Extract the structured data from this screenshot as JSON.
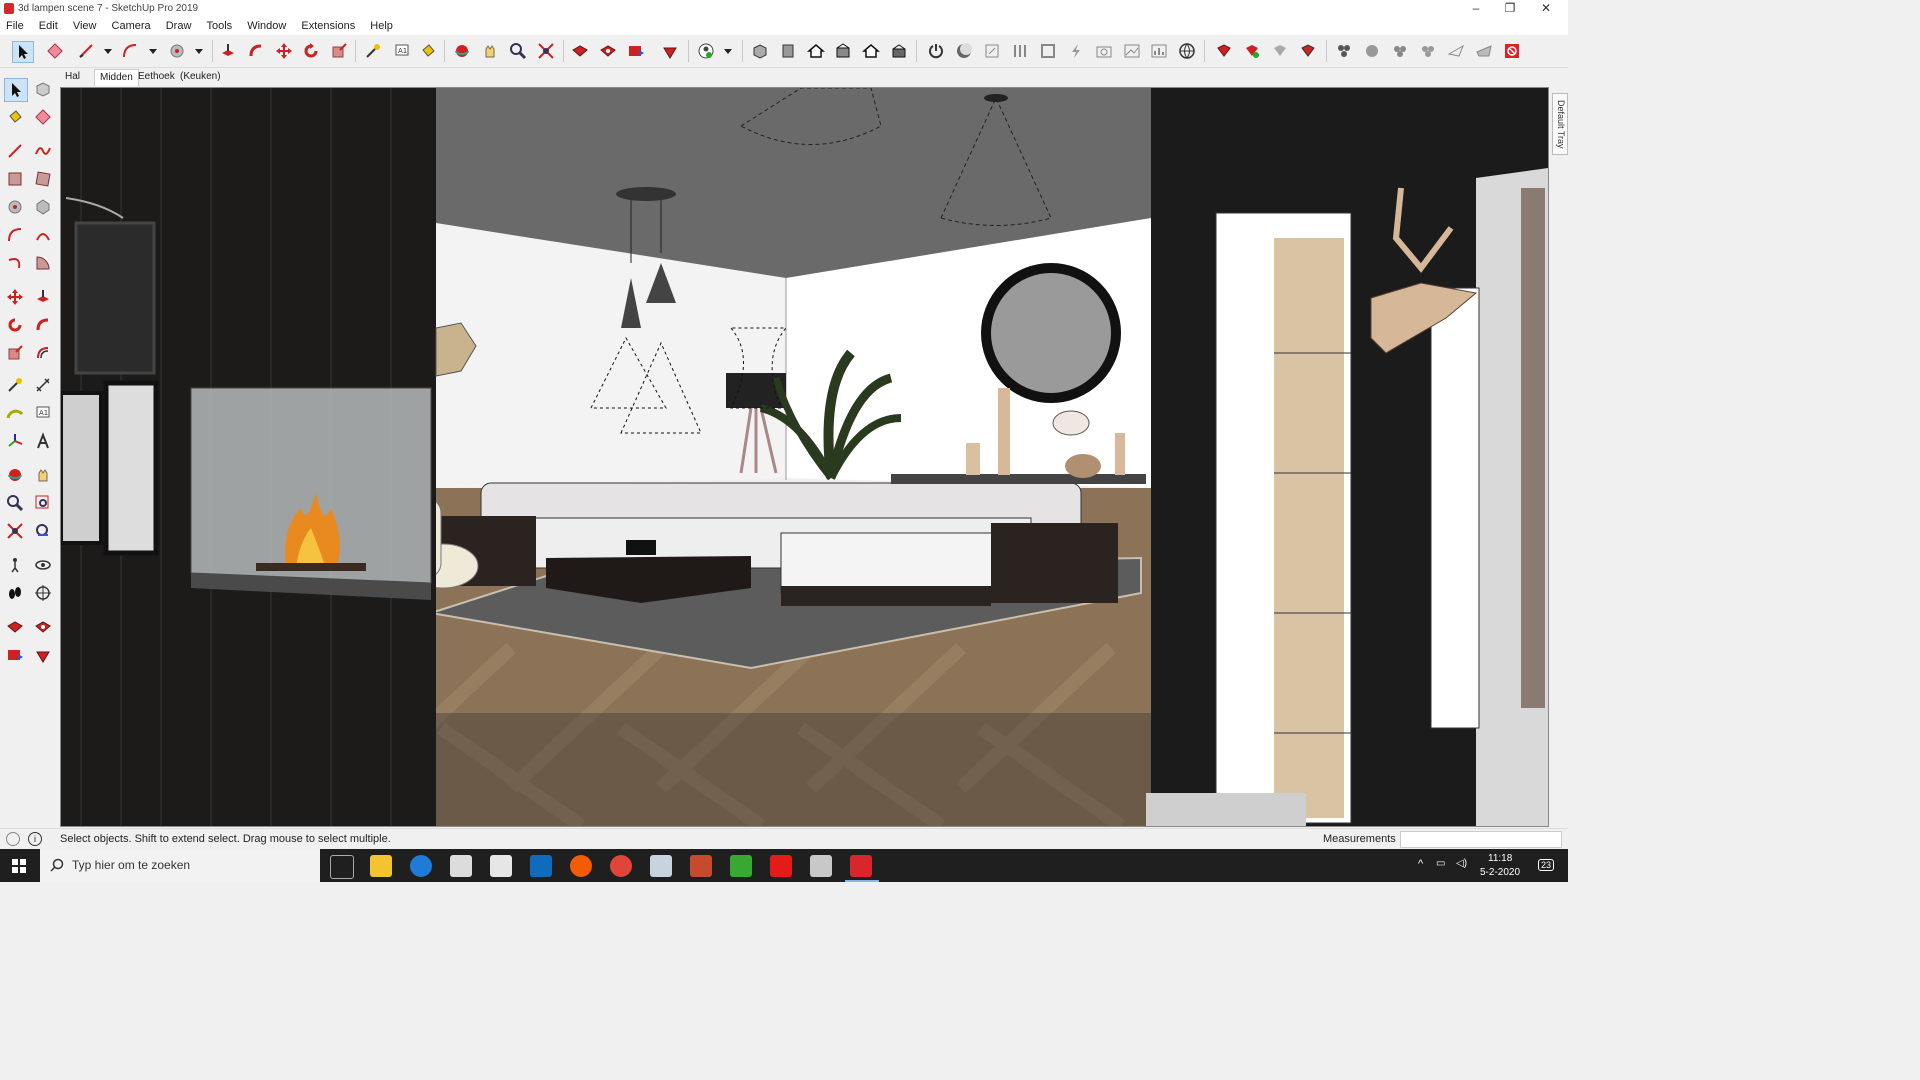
{
  "window": {
    "title": "3d lampen scene 7 - SketchUp Pro 2019",
    "controls": [
      "–",
      "❐",
      "✕"
    ]
  },
  "menu": [
    "File",
    "Edit",
    "View",
    "Camera",
    "Draw",
    "Tools",
    "Window",
    "Extensions",
    "Help"
  ],
  "scenes": {
    "tabs": [
      "Hal",
      "Midden",
      "Eethoek",
      "(Keuken)"
    ],
    "active": "Midden"
  },
  "tray": {
    "label": "Default Tray"
  },
  "status": {
    "hint": "Select objects. Shift to extend select. Drag mouse to select multiple.",
    "measurements_label": "Measurements",
    "measurements_value": ""
  },
  "taskbar": {
    "search_placeholder": "Typ hier om te zoeken",
    "time": "11:18",
    "date": "5-2-2020",
    "notifications": "23"
  },
  "colors": {
    "accent_red": "#d9262c",
    "taskbar": "#1f1f1f",
    "selection": "#cde4f7"
  }
}
